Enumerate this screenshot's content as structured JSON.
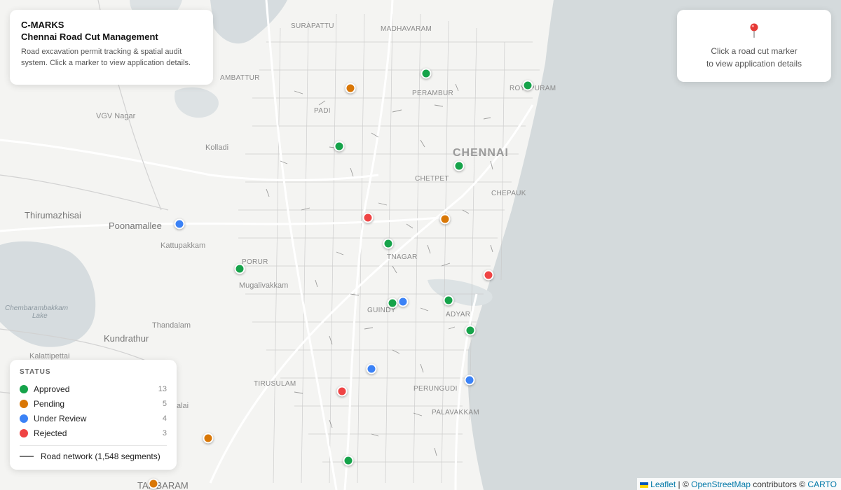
{
  "header": {
    "brand": "C-MARKS",
    "title": "Chennai Road Cut Management",
    "description": "Road excavation permit tracking & spatial audit system. Click a marker to view application details."
  },
  "info_panel": {
    "hint_line1": "Click a road cut marker",
    "hint_line2": "to view application details",
    "icon": "map-pin-icon"
  },
  "legend": {
    "heading": "STATUS",
    "items": [
      {
        "label": "Approved",
        "count": "13",
        "color": "#16a34a"
      },
      {
        "label": "Pending",
        "count": "5",
        "color": "#d97706"
      },
      {
        "label": "Under Review",
        "count": "4",
        "color": "#3b82f6"
      },
      {
        "label": "Rejected",
        "count": "3",
        "color": "#ef4444"
      }
    ],
    "road_label": "Road network (1,548 segments)"
  },
  "status_colors": {
    "approved": "#16a34a",
    "pending": "#d97706",
    "review": "#3b82f6",
    "rejected": "#ef4444"
  },
  "places": {
    "chennai": "CHENNAI",
    "surapattu": "SURAPATTU",
    "madhavaram": "MADHAVARAM",
    "ambattur": "AMBATTUR",
    "perambur": "PERAMBUR",
    "royapuram": "ROYAPURAM",
    "padi": "PADI",
    "vgv_nagar": "VGV Nagar",
    "kolladi": "Kolladi",
    "chetpet": "CHETPET",
    "chepauk": "CHEPAUK",
    "thirumazhisai": "Thirumazhisai",
    "poonamallee": "Poonamallee",
    "kattupakkam": "Kattupakkam",
    "porur": "PORUR",
    "tnagar": "TNAGAR",
    "mugalivakkam": "Mugalivakkam",
    "chembarambakkam": "Chembarambakkam",
    "lake": "Lake",
    "guindy": "GUINDY",
    "adyar": "ADYAR",
    "thandalam": "Thandalam",
    "kundrathur": "Kundrathur",
    "kalattipettai": "Kalattipettai",
    "tirusulam": "TIRUSULAM",
    "perungudi": "PERUNGUDI",
    "palavakkam": "PALAVAKKAM",
    "alai": "alai",
    "tambaram": "TAMBARAM"
  },
  "attribution": {
    "leaflet": "Leaflet",
    "sep1": " | © ",
    "osm": "OpenStreetMap",
    "sep2": " contributors © ",
    "carto": "CARTO"
  }
}
